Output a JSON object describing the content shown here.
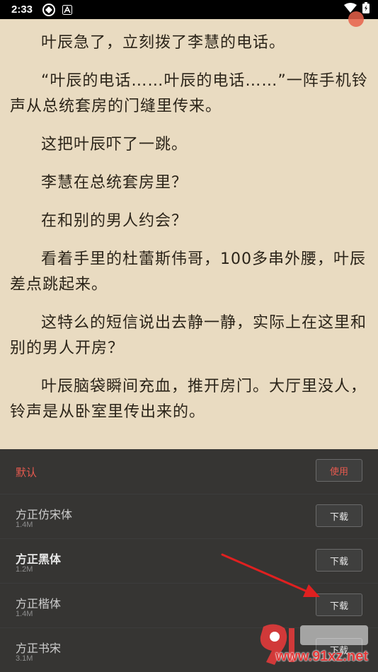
{
  "status_bar": {
    "time": "2:33"
  },
  "reader": {
    "paragraphs": [
      "叶辰急了，立刻拨了李慧的电话。",
      "“叶辰的电话……叶辰的电话……”一阵手机铃声从总统套房的门缝里传来。",
      "这把叶辰吓了一跳。",
      "李慧在总统套房里？",
      "在和别的男人约会？",
      "看着手里的杜蕾斯伟哥，100多串外腰，叶辰差点跳起来。",
      "这特么的短信说出去静一静，实际上在这里和别的男人开房？",
      "叶辰脑袋瞬间充血，推开房门。大厅里没人，铃声是从卧室里传出来的。"
    ]
  },
  "font_panel": {
    "default_label": "默认",
    "use_label": "使用",
    "fonts": [
      {
        "name": "方正仿宋体",
        "size": "1.4M",
        "action": "下载"
      },
      {
        "name": "方正黑体",
        "size": "1.2M",
        "action": "下载"
      },
      {
        "name": "方正楷体",
        "size": "1.4M",
        "action": "下载"
      },
      {
        "name": "方正书宋",
        "size": "3.1M",
        "action": "下载"
      }
    ]
  },
  "watermark": {
    "text": "www.91xz.net"
  },
  "colors": {
    "page_background": "#e9dbc1",
    "panel_background": "#282828",
    "accent_red": "#e85a4f",
    "arrow_red": "#e02020"
  }
}
